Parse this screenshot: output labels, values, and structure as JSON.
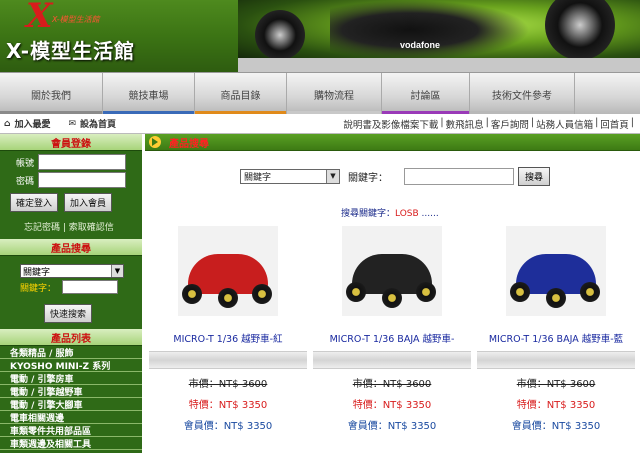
{
  "header": {
    "logo_mark": "X",
    "logo_sub": "X-模型生活館",
    "site_title": "X-模型生活館",
    "banner_text": "vodafone"
  },
  "nav": {
    "items": [
      {
        "label": "關於我們",
        "color": "#8a8a8a"
      },
      {
        "label": "競技車場",
        "color": "#3a6ab8"
      },
      {
        "label": "商品目錄",
        "color": "#e08a1a"
      },
      {
        "label": "購物流程",
        "color": "#c8c8c8"
      },
      {
        "label": "討論區",
        "color": "#9a3ab8"
      },
      {
        "label": "技術文件參考",
        "color": "#b8b8b8"
      }
    ]
  },
  "util": {
    "bookmark": "加入最愛",
    "homepage": "設為首頁",
    "links": [
      "說明書及影像檔案下載",
      "|",
      "數飛訊息",
      "|",
      "客戶詢問",
      "|",
      "站務人員信箱",
      "|",
      "回首頁",
      "|"
    ]
  },
  "sidebar": {
    "member_title": "會員登錄",
    "account_label": "帳號",
    "password_label": "密碼",
    "login_button": "確定登入",
    "join_button": "加入會員",
    "forgot_links": "忘記密碼 | 索取確認信",
    "search_title": "產品搜尋",
    "search_select": "關鍵字",
    "keyword_label": "關鍵字：",
    "search_button": "快速搜索",
    "list_title": "產品列表",
    "categories": [
      "各類精品 / 服飾",
      "KYOSHO MINI-Z 系列",
      "電動 / 引擎房車",
      "電動 / 引擎越野車",
      "電動 / 引擎大腳車",
      "電車相關週邊",
      "車類零件共用部品區",
      "車類週邊及相關工具"
    ]
  },
  "main": {
    "section_title": "產品搜尋",
    "select_value": "關鍵字",
    "keyword_label": "關鍵字：",
    "search_button": "搜尋",
    "keyword_prefix": "搜尋關鍵字：",
    "keyword_value": "LOSB",
    "keyword_suffix": " ......",
    "products": [
      {
        "name": "MICRO-T 1/36 越野車-紅",
        "list_price": "市價：NT$ 3600",
        "special_price": "特價：NT$ 3350",
        "member_price": "會員價：NT$ 3350",
        "body_color": "#c81e1e"
      },
      {
        "name": "MICRO-T 1/36 BAJA 越野車-",
        "list_price": "市價：NT$ 3600",
        "special_price": "特價：NT$ 3350",
        "member_price": "會員價：NT$ 3350",
        "body_color": "#222222"
      },
      {
        "name": "MICRO-T 1/36 BAJA 越野車-藍",
        "list_price": "市價：NT$ 3600",
        "special_price": "特價：NT$ 3350",
        "member_price": "會員價：NT$ 3350",
        "body_color": "#1e2e9a"
      }
    ]
  }
}
